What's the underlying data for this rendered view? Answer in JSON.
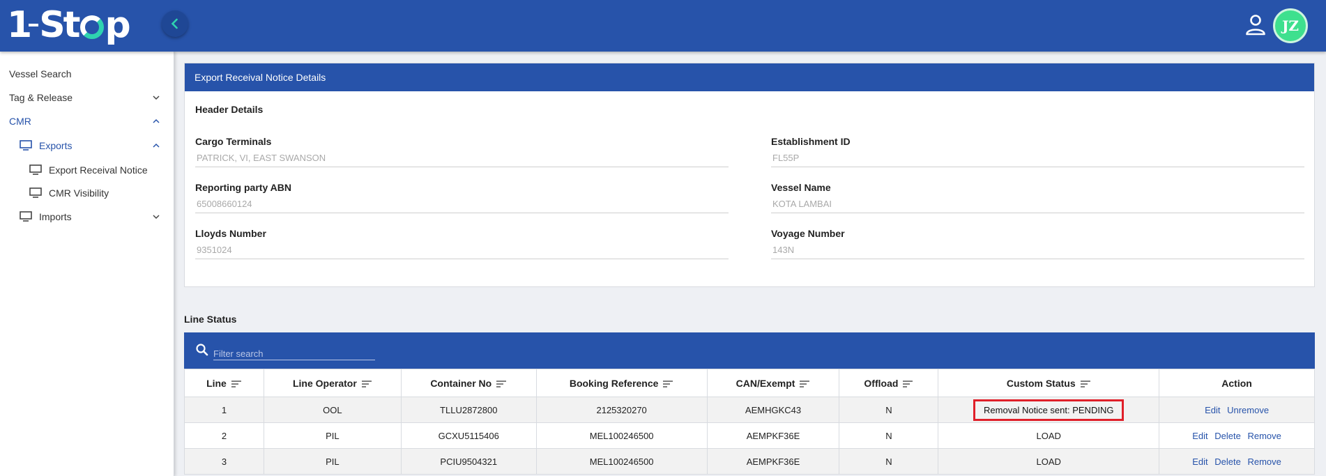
{
  "app": {
    "logo_text_a": "1",
    "logo_text_b": "St",
    "logo_text_c": "p",
    "avatar_initials": "JZ"
  },
  "sidebar": {
    "items": [
      {
        "label": "Vessel Search"
      },
      {
        "label": "Tag & Release"
      },
      {
        "label": "CMR"
      },
      {
        "label": "Exports"
      },
      {
        "label": "Export Receival Notice"
      },
      {
        "label": "CMR Visibility"
      },
      {
        "label": "Imports"
      }
    ]
  },
  "card": {
    "title": "Export Receival Notice Details",
    "section": "Header Details",
    "fields": [
      {
        "label": "Cargo Terminals",
        "value": "PATRICK, VI, EAST SWANSON"
      },
      {
        "label": "Establishment ID",
        "value": "FL55P"
      },
      {
        "label": "Reporting party ABN",
        "value": "65008660124"
      },
      {
        "label": "Vessel Name",
        "value": "KOTA LAMBAI"
      },
      {
        "label": "Lloyds Number",
        "value": "9351024"
      },
      {
        "label": "Voyage Number",
        "value": "143N"
      }
    ]
  },
  "line_status": {
    "title": "Line Status",
    "filter_placeholder": "Filter search",
    "columns": [
      "Line",
      "Line Operator",
      "Container No",
      "Booking Reference",
      "CAN/Exempt",
      "Offload",
      "Custom Status",
      "Action"
    ],
    "rows": [
      {
        "line": "1",
        "operator": "OOL",
        "container": "TLLU2872800",
        "booking": "2125320270",
        "can": "AEMHGKC43",
        "offload": "N",
        "status": "Removal Notice sent: PENDING",
        "actions": [
          "Edit",
          "Unremove"
        ]
      },
      {
        "line": "2",
        "operator": "PIL",
        "container": "GCXU5115406",
        "booking": "MEL100246500",
        "can": "AEMPKF36E",
        "offload": "N",
        "status": "LOAD",
        "actions": [
          "Edit",
          "Delete",
          "Remove"
        ]
      },
      {
        "line": "3",
        "operator": "PIL",
        "container": "PCIU9504321",
        "booking": "MEL100246500",
        "can": "AEMPKF36E",
        "offload": "N",
        "status": "LOAD",
        "actions": [
          "Edit",
          "Delete",
          "Remove"
        ]
      }
    ]
  },
  "colors": {
    "primary": "#2753aa",
    "accent": "#2fd3b0",
    "avatar": "#3ee08e",
    "highlight_border": "#e0202a"
  },
  "icons": [
    "back-chevron-icon",
    "user-icon",
    "chevron-down-icon",
    "chevron-up-icon",
    "monitor-icon",
    "search-icon",
    "sort-icon"
  ]
}
